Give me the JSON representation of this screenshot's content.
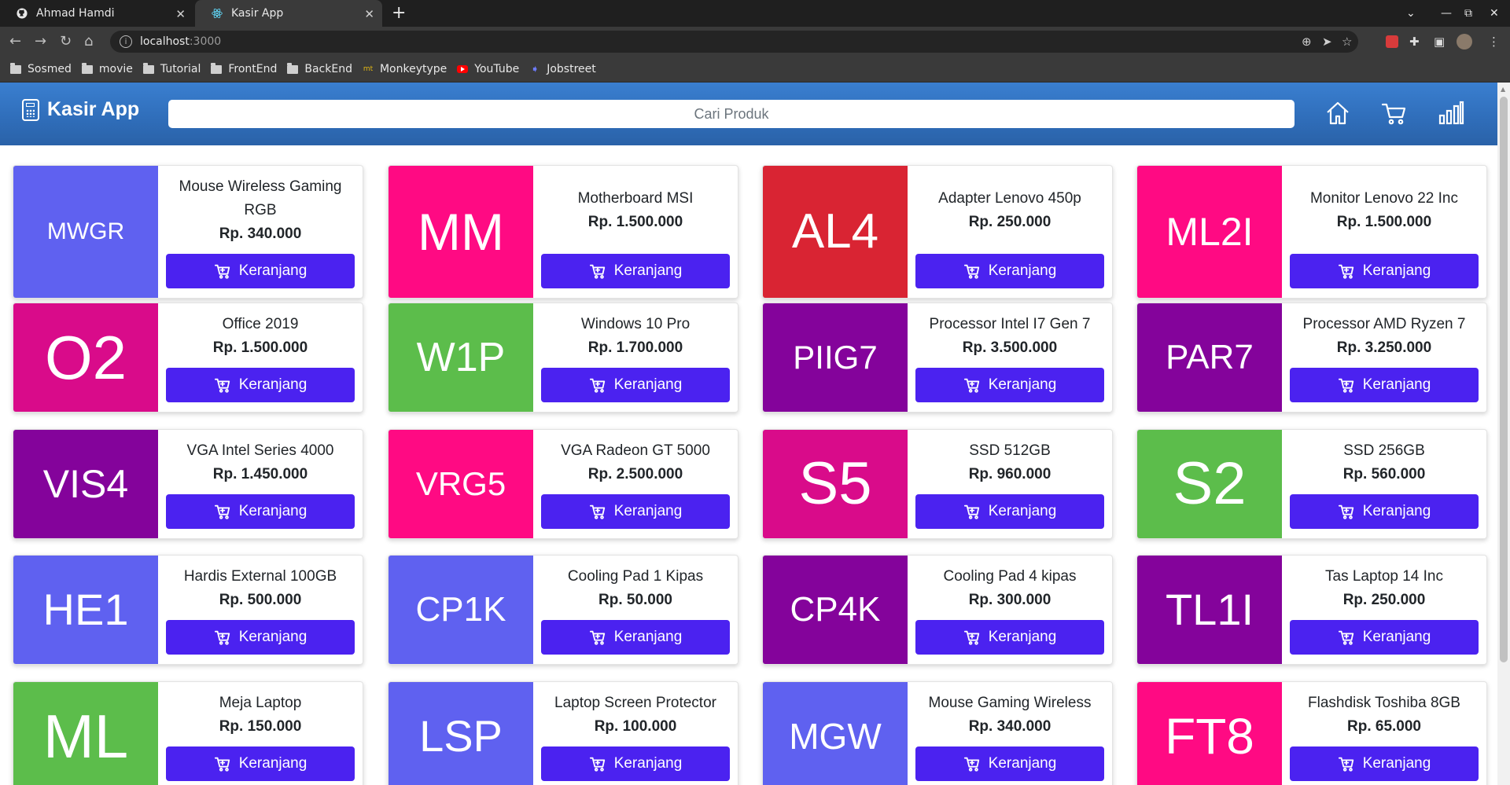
{
  "browser": {
    "tabs": [
      {
        "title": "Ahmad Hamdi",
        "active": false
      },
      {
        "title": "Kasir App",
        "active": true
      }
    ],
    "url_host": "localhost",
    "url_port": ":3000",
    "bookmarks": [
      {
        "label": "Sosmed",
        "icon": "folder-icon"
      },
      {
        "label": "movie",
        "icon": "folder-icon"
      },
      {
        "label": "Tutorial",
        "icon": "folder-icon"
      },
      {
        "label": "FrontEnd",
        "icon": "folder-icon"
      },
      {
        "label": "BackEnd",
        "icon": "folder-icon"
      },
      {
        "label": "Monkeytype",
        "icon": "monkeytype-icon"
      },
      {
        "label": "YouTube",
        "icon": "youtube-icon"
      },
      {
        "label": "Jobstreet",
        "icon": "jobstreet-icon"
      }
    ]
  },
  "app": {
    "brand": "Kasir App",
    "search_placeholder": "Cari Produk",
    "nav_icons": [
      "home-icon",
      "cart-icon",
      "chart-icon"
    ],
    "accent": "#4b22f0",
    "navbar_color": "#2f6db9"
  },
  "products": [
    {
      "code": "MWGR",
      "name": "Mouse Wireless Gaming RGB",
      "price": "Rp. 340.000",
      "color": "#5f61f0",
      "code_size": 30,
      "button": "Keranjang"
    },
    {
      "code": "MM",
      "name": "Motherboard MSI",
      "price": "Rp. 1.500.000",
      "color": "#ff0a83",
      "code_size": 66,
      "button": "Keranjang"
    },
    {
      "code": "AL4",
      "name": "Adapter Lenovo 450p",
      "price": "Rp. 250.000",
      "color": "#d92433",
      "code_size": 62,
      "button": "Keranjang"
    },
    {
      "code": "ML2I",
      "name": "Monitor Lenovo 22 Inc",
      "price": "Rp. 1.500.000",
      "color": "#ff0a83",
      "code_size": 50,
      "button": "Keranjang"
    },
    {
      "code": "O2",
      "name": "Office 2019",
      "price": "Rp. 1.500.000",
      "color": "#d90b8a",
      "code_size": 78,
      "button": "Keranjang"
    },
    {
      "code": "W1P",
      "name": "Windows 10 Pro",
      "price": "Rp. 1.700.000",
      "color": "#5cbd4b",
      "code_size": 52,
      "button": "Keranjang"
    },
    {
      "code": "PIIG7",
      "name": "Processor Intel I7 Gen 7",
      "price": "Rp. 3.500.000",
      "color": "#84039b",
      "code_size": 42,
      "button": "Keranjang"
    },
    {
      "code": "PAR7",
      "name": "Processor AMD Ryzen 7",
      "price": "Rp. 3.250.000",
      "color": "#84039b",
      "code_size": 44,
      "button": "Keranjang"
    },
    {
      "code": "VIS4",
      "name": "VGA Intel Series 4000",
      "price": "Rp. 1.450.000",
      "color": "#84039b",
      "code_size": 50,
      "button": "Keranjang"
    },
    {
      "code": "VRG5",
      "name": "VGA Radeon GT 5000",
      "price": "Rp. 2.500.000",
      "color": "#ff0a83",
      "code_size": 42,
      "button": "Keranjang"
    },
    {
      "code": "S5",
      "name": "SSD 512GB",
      "price": "Rp. 960.000",
      "color": "#d90b8a",
      "code_size": 76,
      "button": "Keranjang"
    },
    {
      "code": "S2",
      "name": "SSD 256GB",
      "price": "Rp. 560.000",
      "color": "#5cbd4b",
      "code_size": 76,
      "button": "Keranjang"
    },
    {
      "code": "HE1",
      "name": "Hardis External 100GB",
      "price": "Rp. 500.000",
      "color": "#5f61f0",
      "code_size": 56,
      "button": "Keranjang"
    },
    {
      "code": "CP1K",
      "name": "Cooling Pad 1 Kipas",
      "price": "Rp. 50.000",
      "color": "#5f61f0",
      "code_size": 44,
      "button": "Keranjang"
    },
    {
      "code": "CP4K",
      "name": "Cooling Pad 4 kipas",
      "price": "Rp. 300.000",
      "color": "#84039b",
      "code_size": 44,
      "button": "Keranjang"
    },
    {
      "code": "TL1I",
      "name": "Tas Laptop 14 Inc",
      "price": "Rp. 250.000",
      "color": "#84039b",
      "code_size": 56,
      "button": "Keranjang"
    },
    {
      "code": "ML",
      "name": "Meja Laptop",
      "price": "Rp. 150.000",
      "color": "#5cbd4b",
      "code_size": 78,
      "button": "Keranjang"
    },
    {
      "code": "LSP",
      "name": "Laptop Screen Protector",
      "price": "Rp. 100.000",
      "color": "#5f61f0",
      "code_size": 56,
      "button": "Keranjang"
    },
    {
      "code": "MGW",
      "name": "Mouse Gaming Wireless",
      "price": "Rp. 340.000",
      "color": "#5f61f0",
      "code_size": 46,
      "button": "Keranjang"
    },
    {
      "code": "FT8",
      "name": "Flashdisk Toshiba 8GB",
      "price": "Rp. 65.000",
      "color": "#ff0a83",
      "code_size": 64,
      "button": "Keranjang"
    }
  ]
}
